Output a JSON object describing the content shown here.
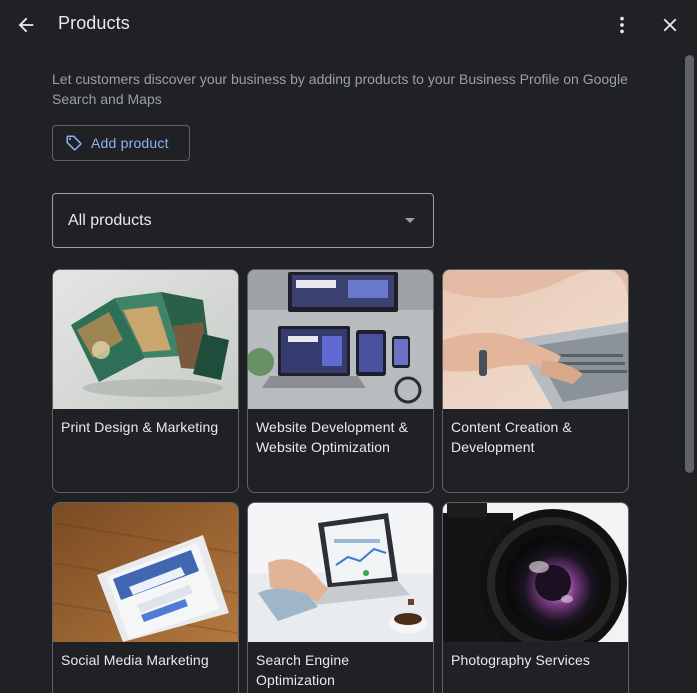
{
  "header": {
    "title": "Products",
    "back_icon": "arrow-back-icon",
    "more_icon": "more-vert-icon",
    "close_icon": "close-icon"
  },
  "intro": "Let customers discover your business by adding products to your Business Profile on Google Search and Maps",
  "add_button": {
    "label": "Add product",
    "icon": "tag-icon"
  },
  "filter": {
    "selected": "All products"
  },
  "products": [
    {
      "name": "Print Design & Marketing",
      "image": "trifold-brochure"
    },
    {
      "name": "Website Development & Website Optimization",
      "image": "devices-mockup"
    },
    {
      "name": "Content Creation & Development",
      "image": "hands-typing-laptop"
    },
    {
      "name": "Social Media Marketing",
      "image": "phone-instagram"
    },
    {
      "name": "Search Engine Optimization",
      "image": "laptop-analytics"
    },
    {
      "name": "Photography Services",
      "image": "camera-lens"
    }
  ],
  "colors": {
    "background": "#202124",
    "accent": "#8ab4f8",
    "border": "#5f6368",
    "text": "#e8eaed",
    "muted": "#9aa0a6"
  }
}
